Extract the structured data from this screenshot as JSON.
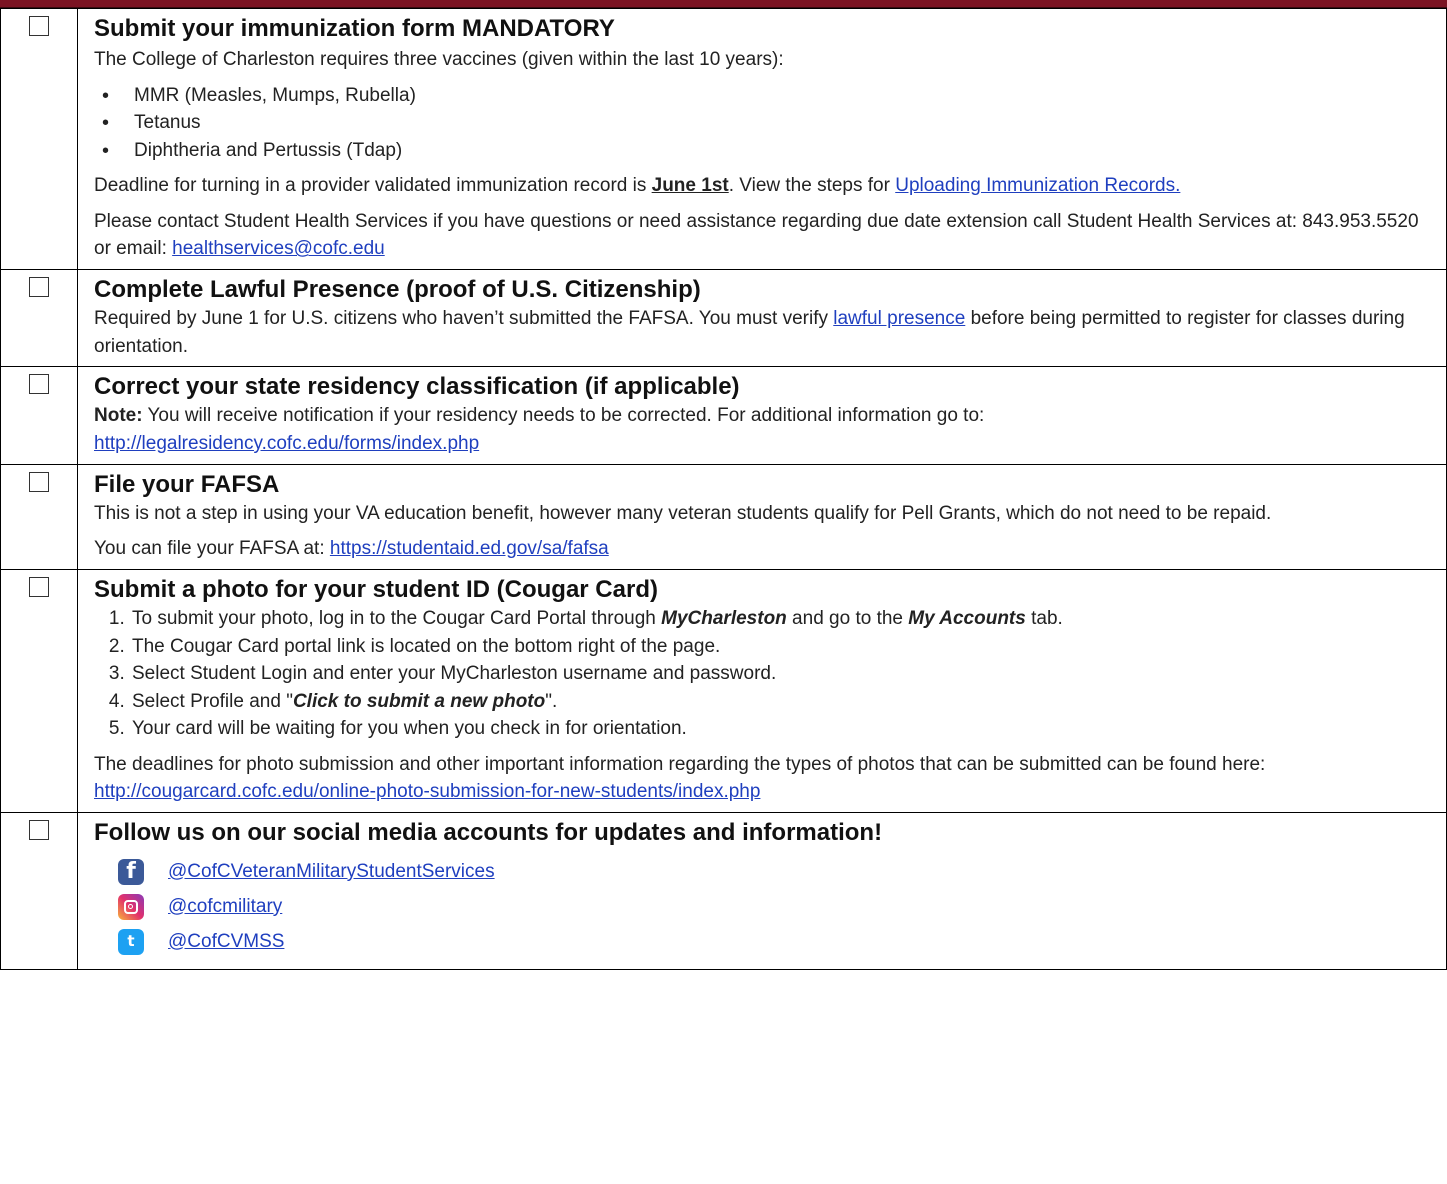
{
  "rows": [
    {
      "title": "Submit your immunization form MANDATORY",
      "intro": "The College of Charleston requires three vaccines (given within the last 10 years):",
      "bullets": [
        "MMR (Measles, Mumps, Rubella)",
        "Tetanus",
        "Diphtheria and Pertussis (Tdap)"
      ],
      "deadline_pre": "Deadline for turning in a provider validated immunization record is ",
      "deadline_date": "June 1st",
      "deadline_mid": ". View the steps for ",
      "deadline_link": "Uploading Immunization Records.",
      "contact_text": "Please contact Student Health Services if you have questions or need assistance regarding due date extension call Student Health Services at: 843.953.5520 or email: ",
      "contact_email": "healthservices@cofc.edu"
    },
    {
      "title": "Complete Lawful Presence (proof of U.S. Citizenship)",
      "text_pre": "Required by June 1 for U.S. citizens who haven’t submitted the FAFSA. You must verify ",
      "link": "lawful presence",
      "text_post": " before being permitted to register for classes during orientation."
    },
    {
      "title": "Correct your state residency classification (if applicable)",
      "note_label": "Note:",
      "note_text": " You will receive notification if your residency needs to be corrected. For additional information go to:",
      "link": "http://legalresidency.cofc.edu/forms/index.php"
    },
    {
      "title": "File your FAFSA",
      "text": "This is not a step in using your VA education benefit, however many veteran students qualify for Pell Grants, which do not need to be repaid.",
      "file_pre": "You can file your FAFSA at: ",
      "link": "https://studentaid.ed.gov/sa/fafsa"
    },
    {
      "title": "Submit a photo for your student ID (Cougar Card)",
      "step1_pre": "To submit your photo, log in to the Cougar Card Portal through ",
      "step1_em1": "MyCharleston",
      "step1_mid": " and go to the ",
      "step1_em2": "My Accounts",
      "step1_post": " tab.",
      "step2": "The Cougar Card portal link is located on the bottom right of the page.",
      "step3": "Select Student Login and enter your MyCharleston username and password.",
      "step4_pre": "Select Profile and \"",
      "step4_em": "Click to submit a new photo",
      "step4_post": "\".",
      "step5": "Your card will be waiting for you when you check in for orientation.",
      "deadline_text": "The deadlines for photo submission and other important information regarding the types of photos that can be submitted can be found here: ",
      "link": "http://cougarcard.cofc.edu/online-photo-submission-for-new-students/index.php"
    },
    {
      "title": "Follow us on our social media accounts for updates and information!",
      "social": [
        {
          "icon": "facebook-icon",
          "handle": "@CofCVeteranMilitaryStudentServices",
          "glyph": "f"
        },
        {
          "icon": "instagram-icon",
          "handle": "@cofcmilitary"
        },
        {
          "icon": "twitter-icon",
          "handle": "@CofCVMSS",
          "glyph": "t"
        }
      ]
    }
  ],
  "colors": {
    "header_bar": "#7b1423",
    "link": "#1f3fbf",
    "facebook": "#3b5998",
    "twitter": "#1da1f2"
  }
}
